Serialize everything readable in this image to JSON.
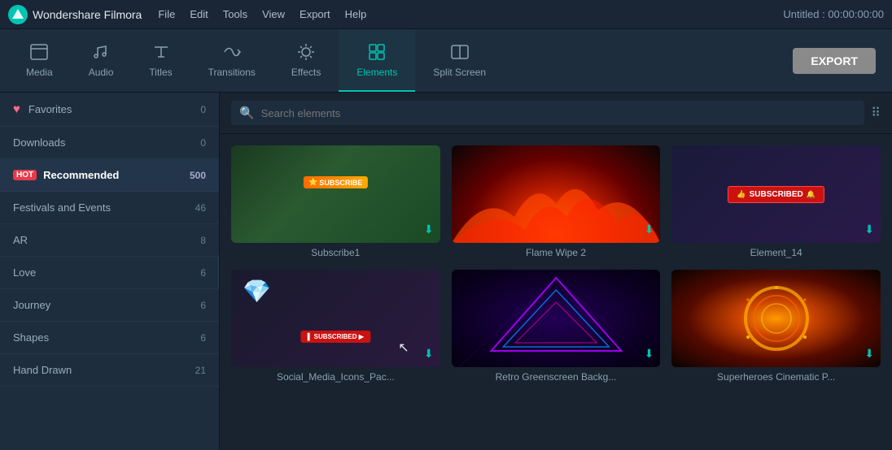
{
  "app": {
    "name": "Wondershare Filmora",
    "title": "Untitled : 00:00:00:00"
  },
  "menu": {
    "items": [
      "File",
      "Edit",
      "Tools",
      "View",
      "Export",
      "Help"
    ]
  },
  "toolbar": {
    "tools": [
      {
        "id": "media",
        "label": "Media",
        "icon": "folder"
      },
      {
        "id": "audio",
        "label": "Audio",
        "icon": "music"
      },
      {
        "id": "titles",
        "label": "Titles",
        "icon": "T"
      },
      {
        "id": "transitions",
        "label": "Transitions",
        "icon": "transition"
      },
      {
        "id": "effects",
        "label": "Effects",
        "icon": "effects"
      },
      {
        "id": "elements",
        "label": "Elements",
        "icon": "elements"
      },
      {
        "id": "split-screen",
        "label": "Split Screen",
        "icon": "split"
      }
    ],
    "active": "elements",
    "export_label": "EXPORT"
  },
  "sidebar": {
    "items": [
      {
        "id": "favorites",
        "label": "Favorites",
        "count": "0",
        "type": "heart"
      },
      {
        "id": "downloads",
        "label": "Downloads",
        "count": "0",
        "type": "normal"
      },
      {
        "id": "recommended",
        "label": "Recommended",
        "count": "500",
        "type": "hot",
        "active": true
      },
      {
        "id": "festivals",
        "label": "Festivals and Events",
        "count": "46",
        "type": "normal"
      },
      {
        "id": "ar",
        "label": "AR",
        "count": "8",
        "type": "normal"
      },
      {
        "id": "love",
        "label": "Love",
        "count": "6",
        "type": "normal"
      },
      {
        "id": "journey",
        "label": "Journey",
        "count": "6",
        "type": "normal"
      },
      {
        "id": "shapes",
        "label": "Shapes",
        "count": "6",
        "type": "normal"
      },
      {
        "id": "hand-drawn",
        "label": "Hand Drawn",
        "count": "21",
        "type": "normal"
      }
    ]
  },
  "search": {
    "placeholder": "Search elements"
  },
  "elements": {
    "cards": [
      {
        "id": "subscribe1",
        "label": "Subscribe1",
        "type": "subscribe"
      },
      {
        "id": "flame-wipe-2",
        "label": "Flame Wipe 2",
        "type": "flame"
      },
      {
        "id": "element-14",
        "label": "Element_14",
        "type": "element14"
      },
      {
        "id": "social-media",
        "label": "Social_Media_Icons_Pac...",
        "type": "social"
      },
      {
        "id": "retro-greenscreen",
        "label": "Retro Greenscreen Backg...",
        "type": "retro"
      },
      {
        "id": "superheroes",
        "label": "Superheroes Cinematic P...",
        "type": "super"
      }
    ]
  }
}
